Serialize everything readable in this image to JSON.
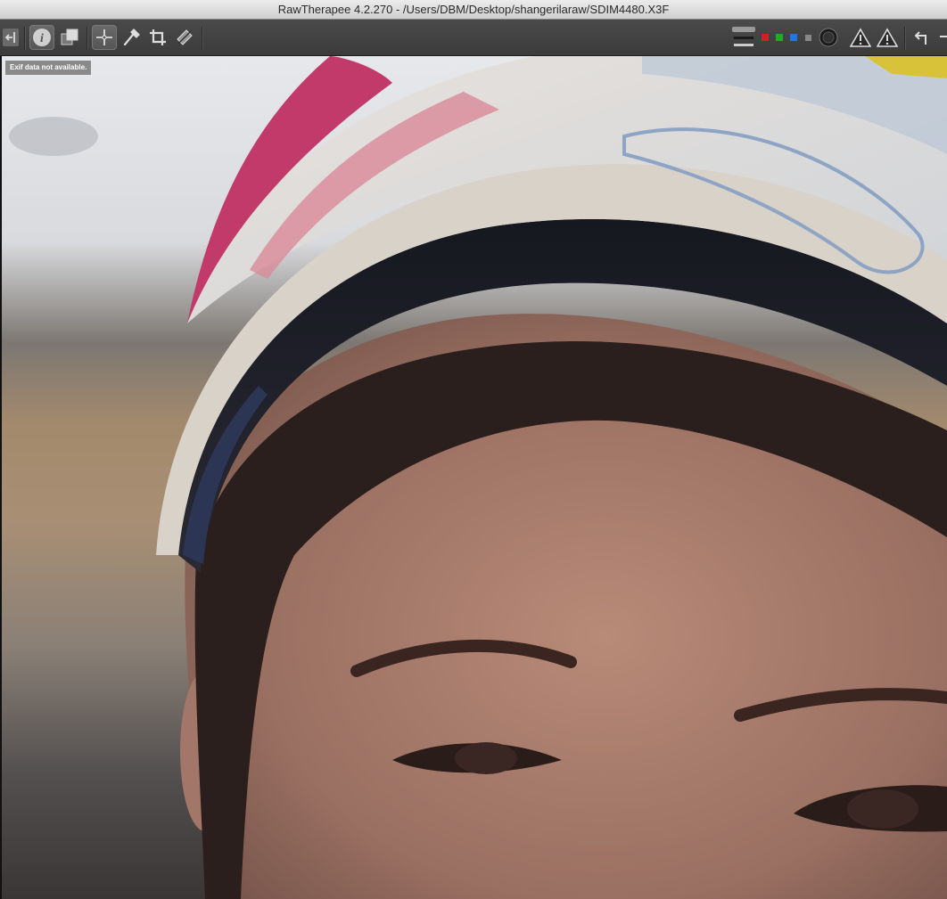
{
  "window": {
    "title": "RawTherapee 4.2.270 - /Users/DBM/Desktop/shangerilaraw/SDIM4480.X3F"
  },
  "viewer": {
    "exif_notice": "Exif data not available."
  },
  "toolbar": {
    "left_icons": [
      "collapse-left-icon",
      "info-icon",
      "before-after-icon",
      "hand-icon",
      "color-picker-icon",
      "crop-icon",
      "straighten-icon"
    ],
    "right_icons": [
      "preview-mode-icon",
      "red-channel-icon",
      "green-channel-icon",
      "blue-channel-icon",
      "luminance-channel-icon",
      "focus-mask-icon",
      "shadow-clipping-warning-icon",
      "highlight-clipping-warning-icon",
      "rotate-left-icon"
    ]
  },
  "colors": {
    "red_channel": "#cc2222",
    "green_channel": "#22aa22",
    "blue_channel": "#2277dd"
  }
}
